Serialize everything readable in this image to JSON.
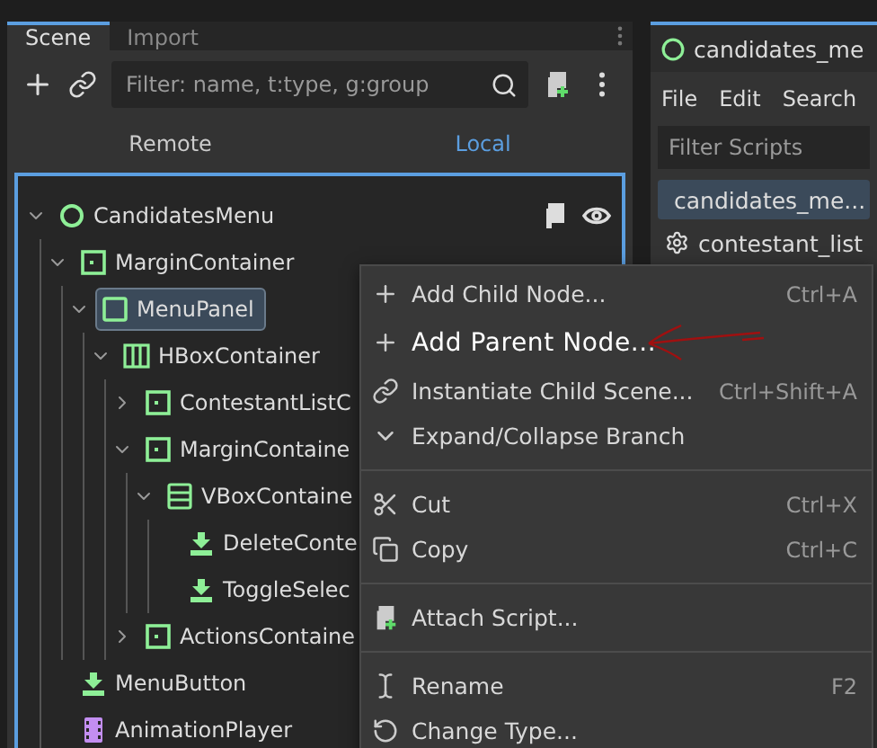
{
  "scene_dock": {
    "tabs": [
      {
        "label": "Scene",
        "selected": true
      },
      {
        "label": "Import",
        "selected": false
      }
    ],
    "filter": {
      "placeholder": "Filter: name, t:type, g:group"
    },
    "modes": [
      {
        "label": "Remote",
        "selected": false
      },
      {
        "label": "Local",
        "selected": true
      }
    ],
    "tree": [
      {
        "name": "CandidatesMenu",
        "kind": "root",
        "expanded": true,
        "selected": false,
        "children": [
          {
            "name": "MarginContainer",
            "kind": "margin",
            "expanded": true,
            "selected": false,
            "children": [
              {
                "name": "MenuPanel",
                "kind": "panel",
                "expanded": true,
                "selected": true,
                "children": [
                  {
                    "name": "HBoxContainer",
                    "kind": "hbox",
                    "expanded": true,
                    "selected": false,
                    "children": [
                      {
                        "name": "ContestantListC",
                        "kind": "margin",
                        "expanded": false,
                        "selected": false
                      },
                      {
                        "name": "MarginContaine",
                        "kind": "margin",
                        "expanded": true,
                        "selected": false,
                        "children": [
                          {
                            "name": "VBoxContaine",
                            "kind": "vbox",
                            "expanded": true,
                            "selected": false,
                            "children": [
                              {
                                "name": "DeleteConte",
                                "kind": "button",
                                "selected": false
                              },
                              {
                                "name": "ToggleSelec",
                                "kind": "button",
                                "selected": false
                              }
                            ]
                          }
                        ]
                      },
                      {
                        "name": "ActionsContaine",
                        "kind": "margin",
                        "expanded": false,
                        "selected": false
                      }
                    ]
                  }
                ]
              }
            ]
          },
          {
            "name": "MenuButton",
            "kind": "button",
            "selected": false
          },
          {
            "name": "AnimationPlayer",
            "kind": "animation",
            "selected": false
          }
        ]
      }
    ]
  },
  "script_editor": {
    "title": "candidates_me",
    "menus": [
      "File",
      "Edit",
      "Search"
    ],
    "filter": {
      "placeholder": "Filter Scripts"
    },
    "scripts": [
      {
        "name": "candidates_me...",
        "selected": true
      },
      {
        "name": "contestant_list",
        "selected": false
      }
    ]
  },
  "context_menu": {
    "items": [
      {
        "kind": "item",
        "label": "Add Child Node...",
        "shortcut": "Ctrl+A",
        "highlighted": false
      },
      {
        "kind": "item",
        "label": "Add Parent Node...",
        "highlighted": true
      },
      {
        "kind": "item",
        "label": "Instantiate Child Scene...",
        "shortcut": "Ctrl+Shift+A",
        "highlighted": false
      },
      {
        "kind": "item",
        "label": "Expand/Collapse Branch",
        "highlighted": false
      },
      {
        "kind": "separator"
      },
      {
        "kind": "item",
        "label": "Cut",
        "shortcut": "Ctrl+X",
        "highlighted": false
      },
      {
        "kind": "item",
        "label": "Copy",
        "shortcut": "Ctrl+C",
        "highlighted": false
      },
      {
        "kind": "separator"
      },
      {
        "kind": "item",
        "label": "Attach Script...",
        "highlighted": false
      },
      {
        "kind": "separator"
      },
      {
        "kind": "item",
        "label": "Rename",
        "shortcut": "F2",
        "highlighted": false
      },
      {
        "kind": "item",
        "label": "Change Type...",
        "highlighted": false
      }
    ]
  }
}
